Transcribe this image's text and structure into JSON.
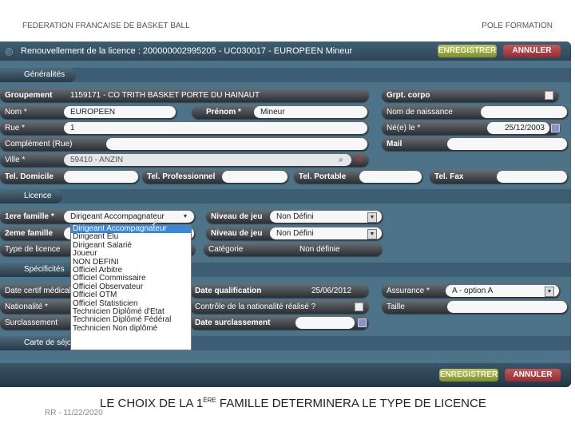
{
  "header": {
    "left": "FEDERATION FRANCAISE DE BASKET BALL",
    "right": "POLE FORMATION"
  },
  "window": {
    "title": "Renouvellement de la licence : 200000002995205 - UC030017 - EUROPEEN Mineur",
    "save": "ENREGISTRER",
    "cancel": "ANNULER"
  },
  "sections": {
    "generalites": "Généralités",
    "licence": "Licence",
    "specificites": "Spécificités",
    "carte": "Carte de séjour"
  },
  "generalites": {
    "groupement": {
      "label": "Groupement",
      "value": "1159171 - CO TRITH BASKET PORTE DU HAINAUT"
    },
    "grpt_corpo": {
      "label": "Grpt. corpo"
    },
    "nom": {
      "label": "Nom *",
      "value": "EUROPEEN"
    },
    "prenom": {
      "label": "Prénom *",
      "value": "Mineur"
    },
    "nom_naissance": {
      "label": "Nom de naissance",
      "value": ""
    },
    "rue": {
      "label": "Rue *",
      "value": "1"
    },
    "nele": {
      "label": "Né(e) le *",
      "value": "25/12/2003"
    },
    "complement": {
      "label": "Complément (Rue)",
      "value": ""
    },
    "mail": {
      "label": "Mail",
      "value": ""
    },
    "ville": {
      "label": "Ville *",
      "value": "59410 - ANZIN"
    },
    "tel_dom": {
      "label": "Tel. Domicile"
    },
    "tel_pro": {
      "label": "Tel. Professionnel"
    },
    "tel_port": {
      "label": "Tel. Portable"
    },
    "tel_fax": {
      "label": "Tel. Fax"
    }
  },
  "licence": {
    "famille1": {
      "label": "1ere famille *",
      "value": "Dirigeant Accompagnateur"
    },
    "famille2": {
      "label": "2eme famille"
    },
    "niveau1": {
      "label": "Niveau de jeu",
      "value": "Non Défini"
    },
    "niveau2": {
      "label": "Niveau de jeu",
      "value": "Non Défini"
    },
    "type": {
      "label": "Type de licence"
    },
    "categorie": {
      "label": "Catégorie",
      "value": "Non définie"
    },
    "options": [
      "Dirigeant Accompagnateur",
      "Dirigeant Elu",
      "Dirigeant Salarié",
      "Joueur",
      "NON DEFINI",
      "Officiel Arbitre",
      "Officiel Commissaire",
      "Officiel Observateur",
      "Officiel OTM",
      "Officiel Statisticien",
      "Technicien Diplômé d'Etat",
      "Technicien Diplômé Fédéral",
      "Technicien Non diplômé"
    ]
  },
  "specificites": {
    "date_certif": {
      "label": "Date certif médical"
    },
    "date_qualif": {
      "label": "Date qualification",
      "value": "25/06/2012"
    },
    "assurance": {
      "label": "Assurance *",
      "value": "A - option A"
    },
    "nationalite": {
      "label": "Nationalité *"
    },
    "controle": {
      "label": "Contrôle de la nationalité réalisé ?"
    },
    "taille": {
      "label": "Taille"
    },
    "surclassement": {
      "label": "Surclassement"
    },
    "date_surclassement": {
      "label": "Date surclassement"
    }
  },
  "caption": {
    "main": "LE CHOIX DE LA 1",
    "sup": "ÈRE",
    "rest": " FAMILLE DETERMINERA LE TYPE DE LICENCE",
    "footer": "RR - 11/22/2020"
  }
}
